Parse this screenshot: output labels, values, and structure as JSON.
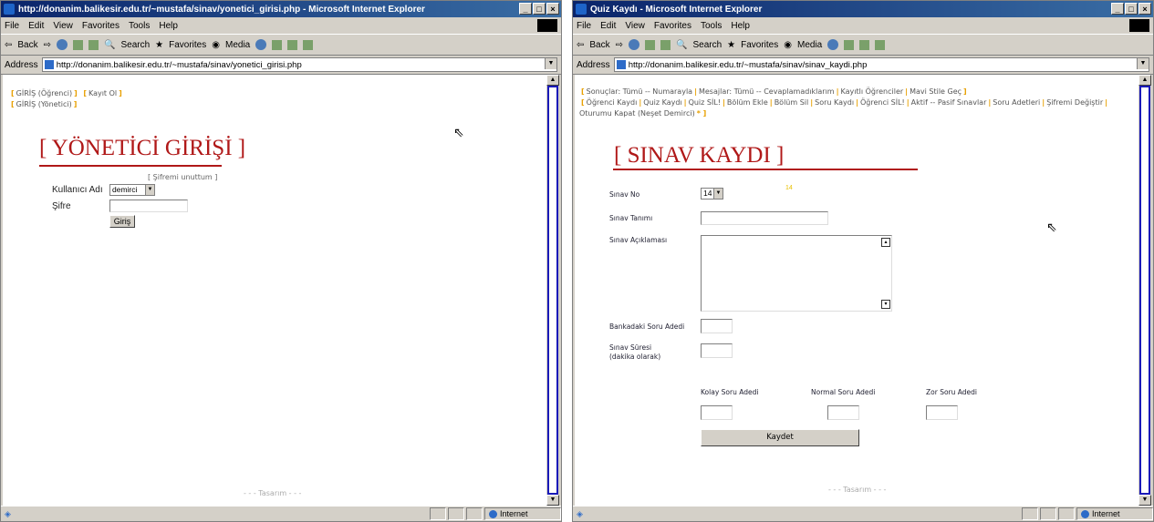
{
  "window1": {
    "title": "http://donanim.balikesir.edu.tr/~mustafa/sinav/yonetici_girisi.php - Microsoft Internet Explorer",
    "menu": [
      "File",
      "Edit",
      "View",
      "Favorites",
      "Tools",
      "Help"
    ],
    "toolbar": {
      "back": "Back",
      "search": "Search",
      "favorites": "Favorites",
      "media": "Media"
    },
    "address_label": "Address",
    "address": "http://donanim.balikesir.edu.tr/~mustafa/sinav/yonetici_girisi.php",
    "nav": {
      "ogrenci_login": "GİRİŞ (Öğrenci)",
      "register": "Kayıt Ol",
      "admin_login": "GİRİŞ (Yönetici)"
    },
    "heading": "[ YÖNETİCİ GİRİŞİ ]",
    "forgot": "[ Şifremi unuttum ]",
    "username_label": "Kullanıcı Adı",
    "username_value": "demirci",
    "password_label": "Şifre",
    "login_button": "Giriş",
    "footer": "- - - Tasarım - - -",
    "status_zone": "Internet"
  },
  "window2": {
    "title": "Quiz Kaydı - Microsoft Internet Explorer",
    "menu": [
      "File",
      "Edit",
      "View",
      "Favorites",
      "Tools",
      "Help"
    ],
    "toolbar": {
      "back": "Back",
      "search": "Search",
      "favorites": "Favorites",
      "media": "Media"
    },
    "address_label": "Address",
    "address": "http://donanim.balikesir.edu.tr/~mustafa/sinav/sinav_kaydi.php",
    "nav": {
      "l1": "Sonuçlar: Tümü -- Numarayla",
      "l2": "Mesajlar: Tümü -- Cevaplamadıklarım",
      "l3": "Kayıtlı Öğrenciler",
      "l4": "Mavi Stile Geç",
      "l5": "Öğrenci Kaydı",
      "l6": "Quiz Kaydı",
      "l7": "Quiz SİL!",
      "l8": "Bölüm Ekle",
      "l9": "Bölüm Sil",
      "l10": "Soru Kaydı",
      "l11": "Öğrenci SİL!",
      "l12": "Aktif -- Pasif Sınavlar",
      "l13": "Soru Adetleri",
      "l14": "Şifremi Değiştir",
      "l15": "Oturumu Kapat (Neşet Demirci)"
    },
    "heading": "[ SINAV KAYDI ]",
    "sinav_no_label": "Sınav No",
    "sinav_no_value": "14",
    "hint": "14",
    "tanim_label": "Sınav Tanımı",
    "aciklama_label": "Sınav Açıklaması",
    "banka_label": "Bankadaki Soru Adedi",
    "sure_label": "Sınav Süresi",
    "sure_sub": "(dakika olarak)",
    "kolay_label": "Kolay Soru Adedi",
    "normal_label": "Normal Soru Adedi",
    "zor_label": "Zor Soru Adedi",
    "save_button": "Kaydet",
    "footer": "- - - Tasarım - - -",
    "status_zone": "Internet"
  }
}
